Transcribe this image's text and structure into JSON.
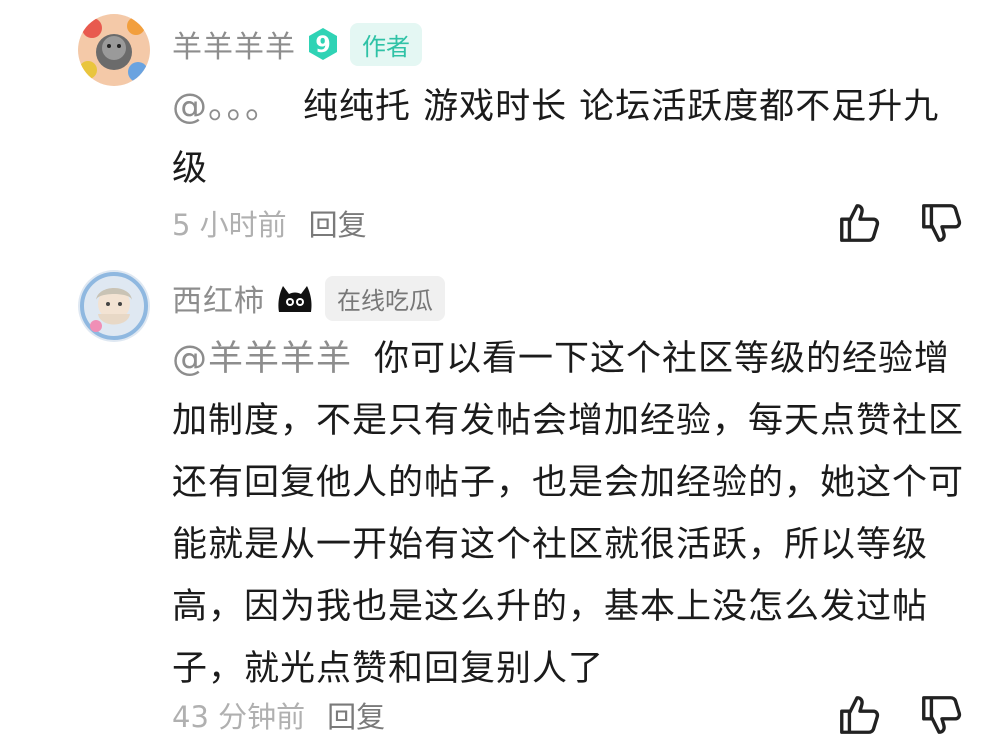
{
  "comments": [
    {
      "author": "羊羊羊羊",
      "level": "9",
      "tag": "作者",
      "mention": "@。。。",
      "text": "纯纯托 游戏时长 论坛活跃度都不足升九级",
      "time": "5 小时前",
      "reply_label": "回复"
    },
    {
      "author": "西红柿",
      "tag": "在线吃瓜",
      "mention": "@羊羊羊羊",
      "text": "你可以看一下这个社区等级的经验增加制度，不是只有发帖会增加经验，每天点赞社区还有回复他人的帖子，也是会加经验的，她这个可能就是从一开始有这个社区就很活跃，所以等级高，因为我也是这么升的，基本上没怎么发过帖子，就光点赞和回复别人了",
      "time": "43 分钟前",
      "reply_label": "回复"
    }
  ],
  "icons": {
    "like": "thumbs-up-icon",
    "dislike": "thumbs-down-icon",
    "level_badge": "level-badge-icon",
    "tag_emoji": "black-cat-icon"
  },
  "colors": {
    "accent": "#2fc2a6",
    "muted_text": "#8d8d8d",
    "body_text": "#1b1b1b"
  }
}
